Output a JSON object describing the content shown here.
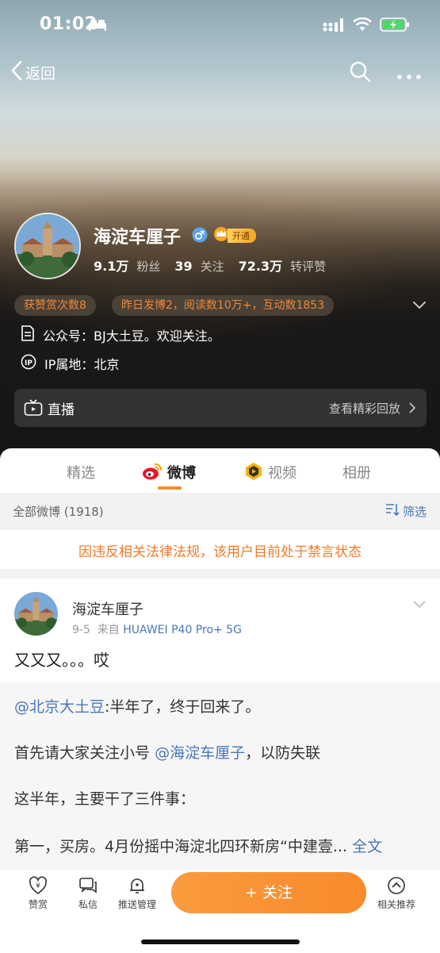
{
  "status": {
    "time": "01:02"
  },
  "nav": {
    "back_label": "返回"
  },
  "profile": {
    "name": "海淀车厘子",
    "vip_badge": "开通",
    "followers_value": "9.1万",
    "followers_label": "粉丝",
    "following_value": "39",
    "following_label": "关注",
    "likes_value": "72.3万",
    "likes_label": "转评赞"
  },
  "chips": {
    "awards": "获赞赏次数8",
    "yesterday": "昨日发博2，阅读数10万+，互动数1853"
  },
  "info": {
    "official": "公众号：BJ大土豆。欢迎关注。",
    "ip": "IP属地：北京"
  },
  "live": {
    "label": "直播",
    "replay": "查看精彩回放"
  },
  "tabs": [
    "精选",
    "微博",
    "视频",
    "相册"
  ],
  "filter": {
    "count_label": "全部微博 (1918)",
    "filter_label": "筛选"
  },
  "notice": "因违反相关法律法规，该用户目前处于禁言状态",
  "post": {
    "author": "海淀车厘子",
    "date": "9-5",
    "source_prefix": "来自",
    "source": "HUAWEI P40 Pro+ 5G",
    "text": "又又又。。。哎",
    "repost": {
      "mention": "@北京大土豆",
      "line1_rest": ":半年了，终于回来了。",
      "line2_pre": "首先请大家关注小号",
      "line2_mention": "@海淀车厘子",
      "line2_post": "，以防失联",
      "line3": "这半年，主要干了三件事：",
      "line4": "第一，买房。4月份摇中海淀北四环新房“中建壹...",
      "full_text": "全文"
    }
  },
  "bottom": {
    "reward": "赞赏",
    "message": "私信",
    "push": "推送管理",
    "follow": "+ 关注",
    "related": "相关推荐"
  },
  "colors": {
    "accent": "#f78b2c",
    "link": "#4a77b8"
  }
}
